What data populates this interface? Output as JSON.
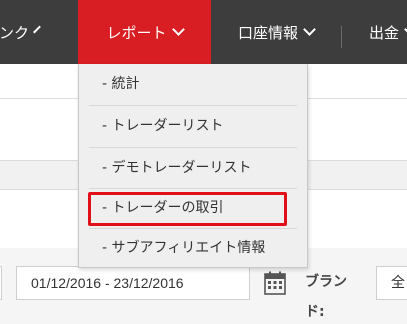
{
  "nav": {
    "link_label": "リンク",
    "report_label": "レポート",
    "account_label": "口座情報",
    "payout_label": "出金"
  },
  "dropdown": {
    "items": [
      {
        "label": "- 統計"
      },
      {
        "label": "- トレーダーリスト"
      },
      {
        "label": "- デモトレーダーリスト"
      },
      {
        "label": "- トレーダーの取引"
      },
      {
        "label": "- サブアフィリエイト情報"
      }
    ],
    "highlighted_index": 3
  },
  "filters": {
    "date_range": "01/12/2016 - 23/12/2016",
    "brand_label": "ブランド:",
    "brand_value": "全"
  },
  "colors": {
    "navbar": "#3d3d3d",
    "active_tab": "#d81e22",
    "highlight": "#e00f1a"
  }
}
